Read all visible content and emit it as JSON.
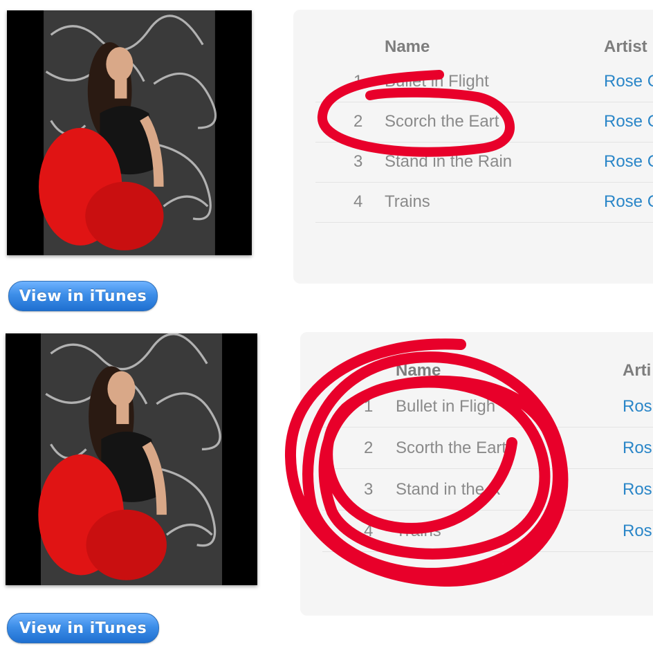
{
  "colors": {
    "accent": "#2a86c8",
    "button": "#3d8ee8",
    "panel": "#f5f5f5",
    "annotation": "#e8002a"
  },
  "blocks": [
    {
      "button_label": "View in iTunes",
      "table": {
        "headers": {
          "name": "Name",
          "artist": "Artist"
        },
        "rows": [
          {
            "num": "1",
            "name": "Bullet in Flight",
            "artist": "Rose C"
          },
          {
            "num": "2",
            "name": "Scorch the Eart",
            "artist": "Rose C"
          },
          {
            "num": "3",
            "name": "Stand in the Rain",
            "artist": "Rose C"
          },
          {
            "num": "4",
            "name": "Trains",
            "artist": "Rose C"
          }
        ]
      }
    },
    {
      "button_label": "View in iTunes",
      "table": {
        "headers": {
          "name": "Name",
          "artist": "Arti"
        },
        "rows": [
          {
            "num": "1",
            "name": "Bullet in Fligh",
            "artist": "Ros"
          },
          {
            "num": "2",
            "name": "Scorth the Eart",
            "artist": "Ros"
          },
          {
            "num": "3",
            "name": "Stand in the R",
            "artist": "Ros"
          },
          {
            "num": "4",
            "name": "Trains",
            "artist": "Ros"
          }
        ]
      }
    }
  ],
  "icons": [
    "album-cover-image",
    "annotation-circle"
  ]
}
